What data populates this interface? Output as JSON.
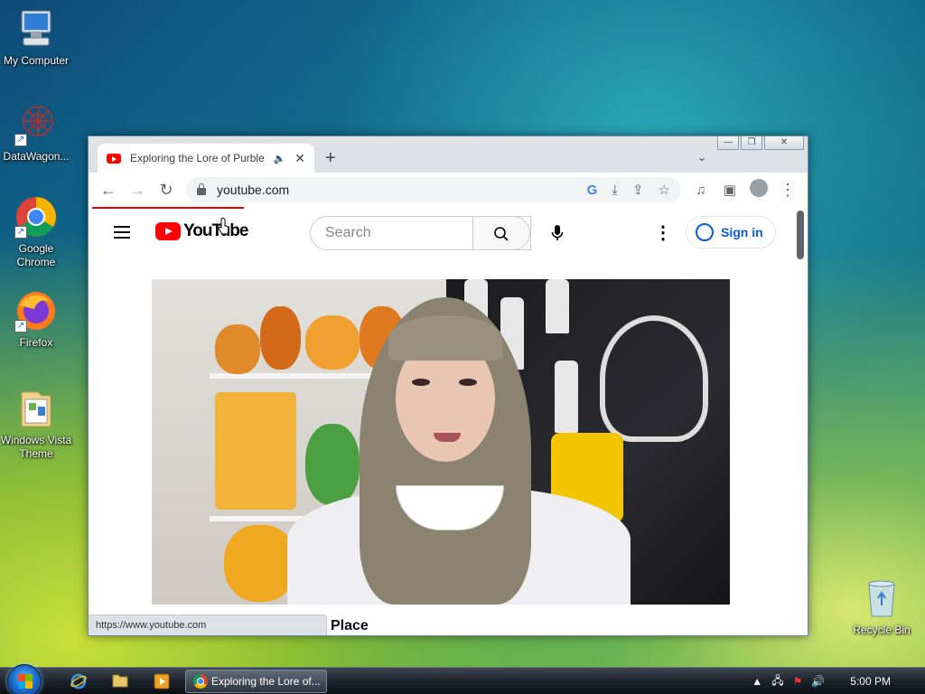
{
  "desktop": {
    "icons": [
      {
        "label": "My Computer"
      },
      {
        "label": "DataWagon..."
      },
      {
        "label": "Google Chrome"
      },
      {
        "label": "Firefox"
      },
      {
        "label": "Windows Vista Theme"
      },
      {
        "label": "Recycle Bin"
      }
    ]
  },
  "browser": {
    "tab": {
      "title": "Exploring the Lore of Purble",
      "audio_icon": "speaker-icon",
      "close": "✕"
    },
    "new_tab": "+",
    "tab_search": "⌄",
    "window_controls": {
      "minimize": "—",
      "maximize": "❐",
      "close": "✕"
    },
    "toolbar": {
      "back": "←",
      "forward": "→",
      "reload": "↻",
      "url": "youtube.com"
    },
    "status_url": "https://www.youtube.com"
  },
  "youtube": {
    "logo_text": "YouTube",
    "search_placeholder": "Search",
    "sign_in": "Sign in",
    "video_title_partial": "Place"
  },
  "taskbar": {
    "task_button": "Exploring the Lore of...",
    "clock": "5:00 PM"
  }
}
